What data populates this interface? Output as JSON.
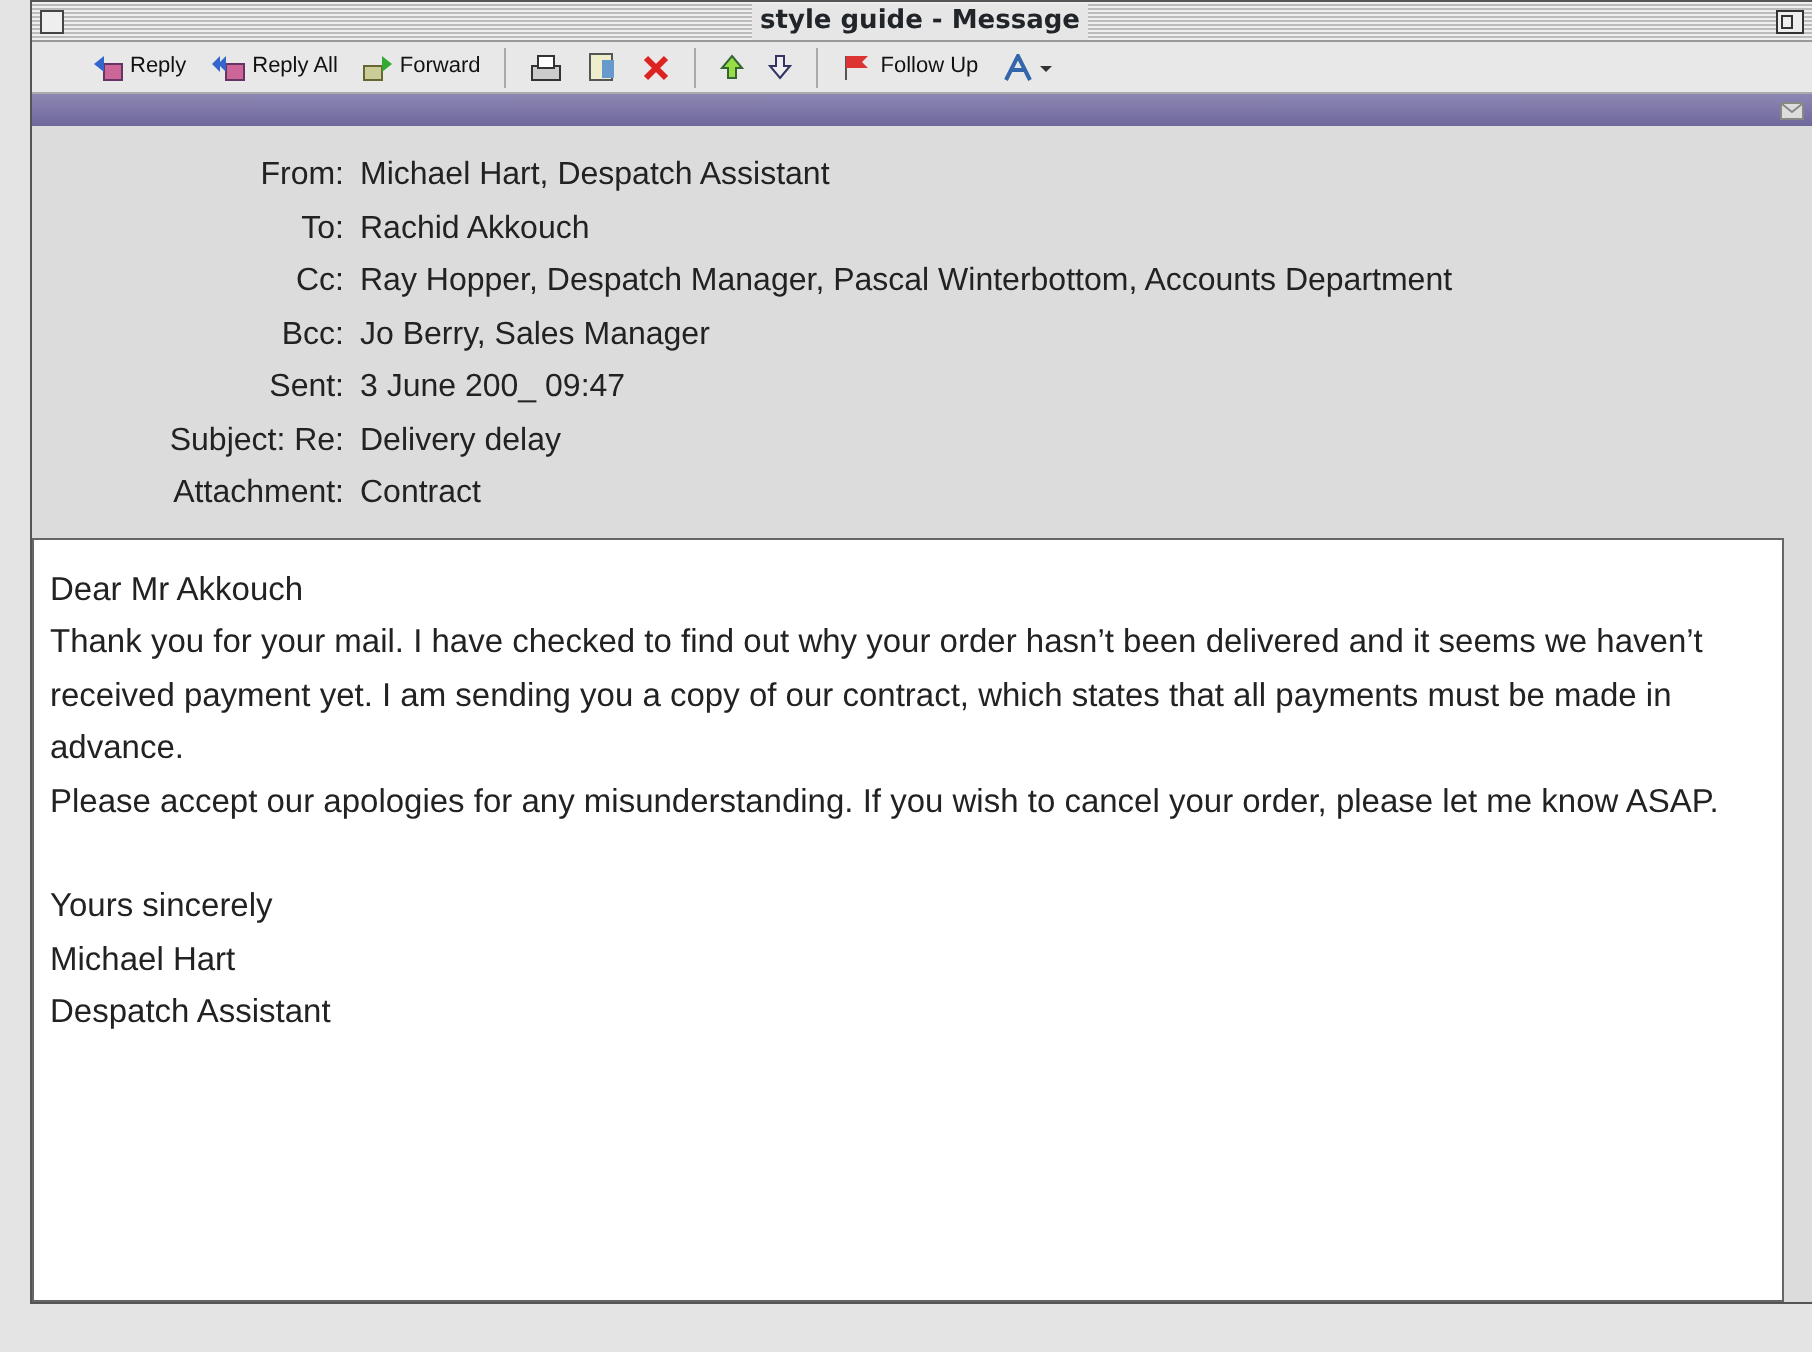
{
  "window": {
    "title": "style guide - Message"
  },
  "toolbar": [
    {
      "kind": "reply",
      "label": "Reply"
    },
    {
      "kind": "replyall",
      "label": "Reply All"
    },
    {
      "kind": "forward",
      "label": "Forward"
    },
    {
      "kind": "sep"
    },
    {
      "kind": "print"
    },
    {
      "kind": "save"
    },
    {
      "kind": "delete"
    },
    {
      "kind": "sep"
    },
    {
      "kind": "up"
    },
    {
      "kind": "down"
    },
    {
      "kind": "sep"
    },
    {
      "kind": "flag",
      "label": "Follow Up"
    },
    {
      "kind": "font"
    }
  ],
  "header_fields": [
    {
      "label": "From:",
      "value": "Michael Hart, Despatch Assistant"
    },
    {
      "label": "To:",
      "value": "Rachid Akkouch"
    },
    {
      "label": "Cc:",
      "value": "Ray Hopper, Despatch Manager, Pascal Winterbottom, Accounts Department"
    },
    {
      "label": "Bcc:",
      "value": "Jo Berry, Sales Manager"
    },
    {
      "label": "Sent:",
      "value": "3 June 200_ 09:47"
    },
    {
      "label": "Subject: Re:",
      "value": "Delivery delay"
    },
    {
      "label": "Attachment:",
      "value": "Contract"
    }
  ],
  "body": [
    {
      "kind": "line",
      "text": "Dear Mr Akkouch"
    },
    {
      "kind": "line",
      "text": "Thank you for your mail. I have checked to find out why your order hasn’t been delivered and it seems we haven’t received payment yet. I am sending you a copy of our contract, which states that all payments must be made in advance."
    },
    {
      "kind": "line",
      "text": "Please accept our apologies for any misunderstanding. If you wish to cancel your order, please let me know ASAP."
    },
    {
      "kind": "gap"
    },
    {
      "kind": "line",
      "text": "Yours sincerely"
    },
    {
      "kind": "line",
      "text": "Michael Hart"
    },
    {
      "kind": "line",
      "text": "Despatch Assistant"
    }
  ]
}
